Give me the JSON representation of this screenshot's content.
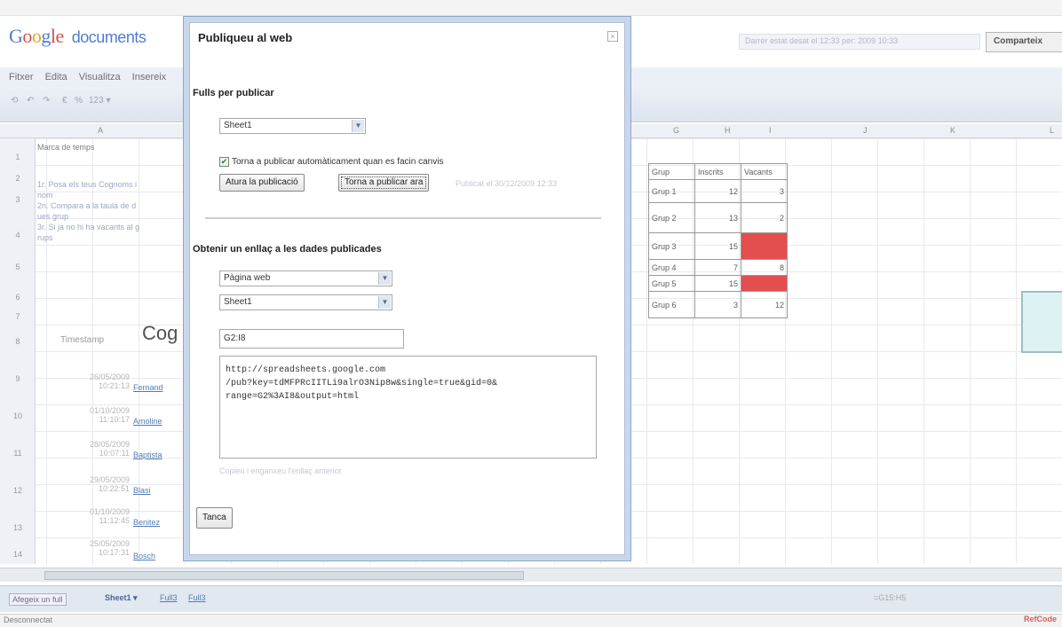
{
  "app": {
    "logo_google": "Google",
    "logo_product": "documents",
    "saved_status": "Darrer estat desat el 12:33 per: 2009 10:33",
    "share_button": "Comparteix"
  },
  "menubar": {
    "items": [
      "Fitxer",
      "Edita",
      "Visualitza",
      "Insereix"
    ]
  },
  "toolbar": {
    "items": [
      "⟲",
      "↶",
      "↷",
      "€",
      "%",
      "123 ▾"
    ]
  },
  "columns": [
    "A",
    "G",
    "H",
    "I",
    "J",
    "K",
    "L"
  ],
  "rows": [
    "1",
    "2",
    "3",
    "4",
    "5",
    "6",
    "7",
    "8",
    "9",
    "10",
    "11",
    "12",
    "13",
    "14"
  ],
  "left_cells": {
    "header": "Marca de temps",
    "notes": [
      "1r. Posa els teus Cognoms i",
      "nom",
      "2n. Compara a la taula de d",
      "ues grup",
      "3r. Si ja no hi ha vacants al g",
      "rups"
    ],
    "title": "Cog",
    "timestamp_label": "Timestamp",
    "entries": [
      {
        "date": "26/05/2009",
        "time": "10:21:13",
        "name": "Fernand"
      },
      {
        "date": "01/10/2009",
        "time": "11:10:17",
        "name": "Amoline"
      },
      {
        "date": "28/05/2009",
        "time": "10:07:11",
        "name": "Baptista"
      },
      {
        "date": "29/05/2009",
        "time": "10:22:51",
        "name": "Blasi"
      },
      {
        "date": "01/10/2009",
        "time": "11:12:45",
        "name": "Benitez"
      },
      {
        "date": "25/05/2009",
        "time": "10:17:31",
        "name": "Bosch"
      }
    ]
  },
  "data_table": {
    "headers": [
      "Grup",
      "Inscrits",
      "Vacants"
    ],
    "rows": [
      {
        "grup": "Grup 1",
        "inscrits": "12",
        "vacants": "3",
        "full": false
      },
      {
        "grup": "Grup 2",
        "inscrits": "13",
        "vacants": "2",
        "full": false
      },
      {
        "grup": "Grup 3",
        "inscrits": "15",
        "vacants": "0",
        "full": true
      },
      {
        "grup": "Grup 4",
        "inscrits": "7",
        "vacants": "8",
        "full": false
      },
      {
        "grup": "Grup 5",
        "inscrits": "15",
        "vacants": "0",
        "full": true
      },
      {
        "grup": "Grup 6",
        "inscrits": "3",
        "vacants": "12",
        "full": false
      }
    ],
    "full_color": "#e03030"
  },
  "sheet_tabs": {
    "add_sheet": "Afegeix un full",
    "active": "Sheet1 ▾",
    "others": [
      "Full3",
      "Full3"
    ],
    "cell_ref": "=G15:H5"
  },
  "statusbar": {
    "text": "Desconnectat",
    "brand": "RefCode"
  },
  "dialog": {
    "title": "Publiqueu al web",
    "close_icon": "×",
    "section1_title": "Fulls per publicar",
    "sheet_select": "Sheet1",
    "auto_republish": "Torna a publicar automàticament quan es facin canvis",
    "auto_republish_checked": true,
    "stop_button": "Atura la publicació",
    "republish_button": "Torna a publicar ara",
    "republished_note": "Publicat el 30/12/2009 12:33",
    "section2_title": "Obtenir un enllaç a les dades publicades",
    "format_select": "Pàgina web",
    "sheet_select2": "Sheet1",
    "range_value": "G2:I8",
    "link_text": "http://spreadsheets.google.com\n/pub?key=tdMFPRcIITLi9alrO3Nip8w&single=true&gid=0&\nrange=G2%3AI8&output=html",
    "copy_hint": "Copieu i enganxeu l'enllaç anterior",
    "close_button": "Tanca"
  }
}
